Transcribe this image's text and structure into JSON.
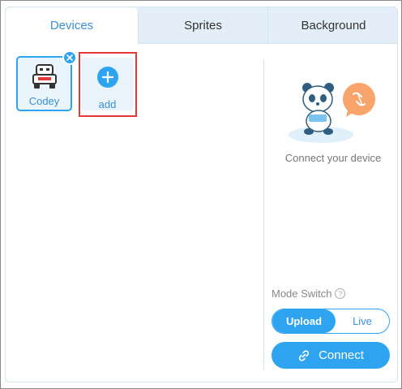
{
  "tabs": [
    {
      "label": "Devices",
      "active": true
    },
    {
      "label": "Sprites",
      "active": false
    },
    {
      "label": "Background",
      "active": false
    }
  ],
  "devices": [
    {
      "name": "Codey",
      "icon": "robot-icon",
      "selected": true
    }
  ],
  "add_device": {
    "label": "add",
    "icon": "plus-icon"
  },
  "connect_panel": {
    "message": "Connect your device",
    "illustration": "panda-disconnected-illustration",
    "mode_switch_label": "Mode Switch",
    "mode_options": [
      "Upload",
      "Live"
    ],
    "selected_mode": "Upload",
    "connect_label": "Connect",
    "connect_icon": "link-icon"
  },
  "colors": {
    "accent": "#2ea4f0",
    "tab_active_text": "#3c8fd8",
    "highlight": "#e53935",
    "panel_bg": "#eef5fb",
    "disconnect_badge": "#f9a46b"
  }
}
